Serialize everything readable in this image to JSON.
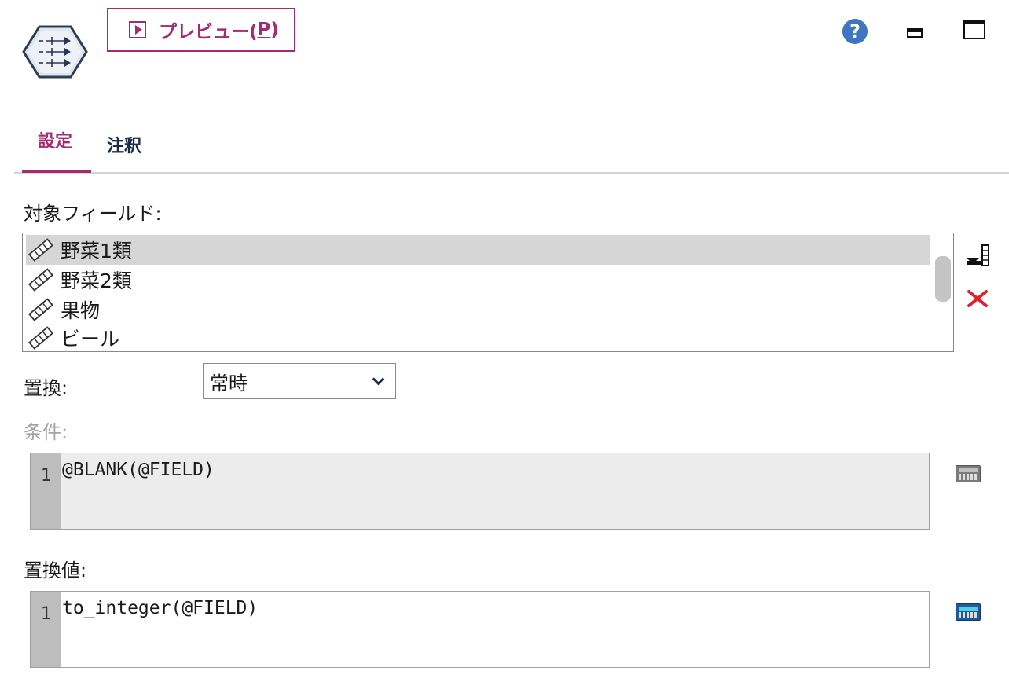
{
  "header": {
    "node_icon": "filler-node-icon",
    "preview": {
      "label_prefix": "プレビュー(",
      "mnemonic": "P",
      "label_suffix": ")"
    },
    "help_icon": "help-icon",
    "help_glyph": "?",
    "minimize_icon": "minimize-icon",
    "maximize_icon": "maximize-icon"
  },
  "tabs": [
    {
      "label": "設定",
      "active": true
    },
    {
      "label": "注釈",
      "active": false
    }
  ],
  "fields": {
    "label": "対象フィールド:",
    "items": [
      {
        "name": "野菜1類",
        "selected": true,
        "icon": "continuous-field-icon"
      },
      {
        "name": "野菜2類",
        "selected": false,
        "icon": "continuous-field-icon"
      },
      {
        "name": "果物",
        "selected": false,
        "icon": "continuous-field-icon"
      },
      {
        "name": "ビール",
        "selected": false,
        "icon": "continuous-field-icon"
      }
    ],
    "add_icon": "field-picker-icon",
    "remove_icon": "delete-icon"
  },
  "replace": {
    "label": "置換:",
    "selected": "常時"
  },
  "condition": {
    "label": "条件:",
    "line_number": "1",
    "code": "@BLANK(@FIELD)",
    "disabled": true,
    "calc_icon": "expression-builder-icon"
  },
  "replace_value": {
    "label": "置換値:",
    "line_number": "1",
    "code": "to_integer(@FIELD)",
    "calc_icon": "expression-builder-icon"
  },
  "colors": {
    "accent": "#a62a72",
    "help_blue": "#3e76c4",
    "delete_red": "#e0202a",
    "selection": "#d6d6d6"
  }
}
